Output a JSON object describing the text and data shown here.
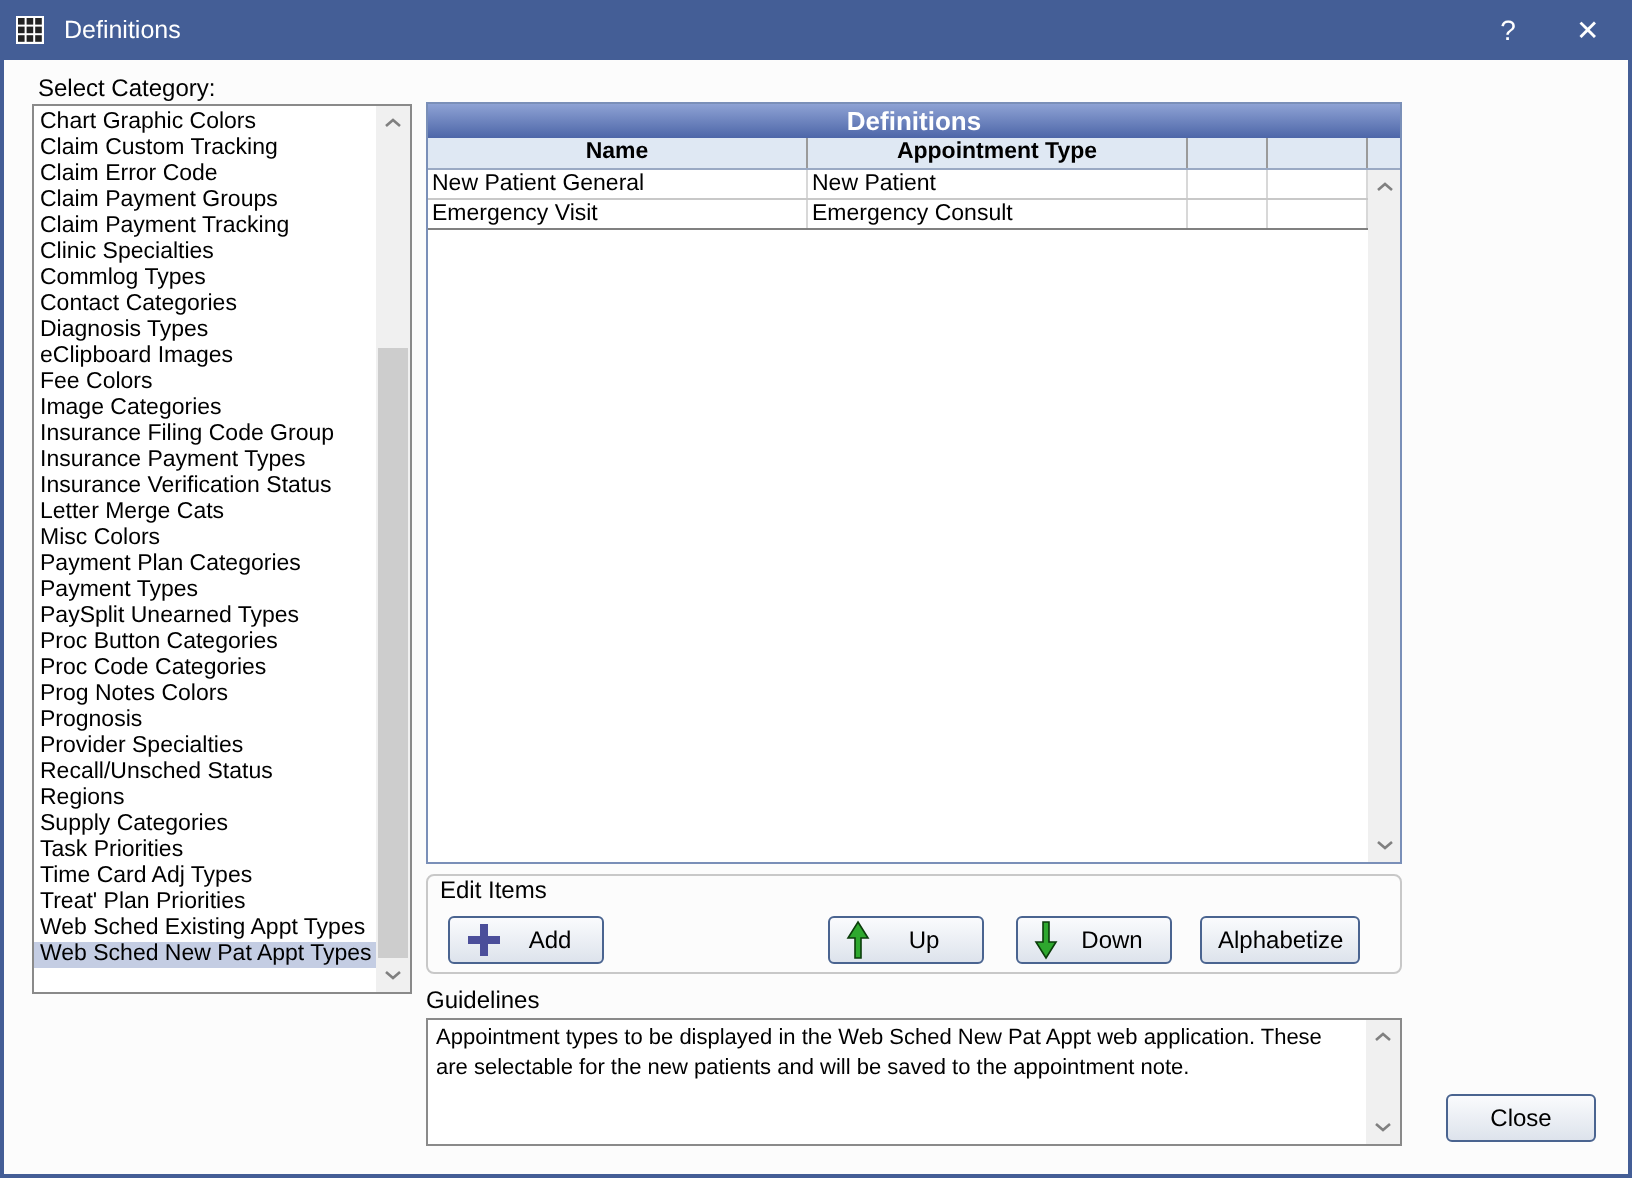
{
  "window": {
    "title": "Definitions",
    "help": "?",
    "close": "✕"
  },
  "category_list": {
    "label": "Select Category:",
    "items": [
      {
        "label": "Chart Graphic Colors",
        "selected": false
      },
      {
        "label": "Claim Custom Tracking",
        "selected": false
      },
      {
        "label": "Claim Error Code",
        "selected": false
      },
      {
        "label": "Claim Payment Groups",
        "selected": false
      },
      {
        "label": "Claim Payment Tracking",
        "selected": false
      },
      {
        "label": "Clinic Specialties",
        "selected": false
      },
      {
        "label": "Commlog Types",
        "selected": false
      },
      {
        "label": "Contact Categories",
        "selected": false
      },
      {
        "label": "Diagnosis Types",
        "selected": false
      },
      {
        "label": "eClipboard Images",
        "selected": false
      },
      {
        "label": "Fee Colors",
        "selected": false
      },
      {
        "label": "Image Categories",
        "selected": false
      },
      {
        "label": "Insurance Filing Code Group",
        "selected": false
      },
      {
        "label": "Insurance Payment Types",
        "selected": false
      },
      {
        "label": "Insurance Verification Status",
        "selected": false
      },
      {
        "label": "Letter Merge Cats",
        "selected": false
      },
      {
        "label": "Misc Colors",
        "selected": false
      },
      {
        "label": "Payment Plan Categories",
        "selected": false
      },
      {
        "label": "Payment Types",
        "selected": false
      },
      {
        "label": "PaySplit Unearned Types",
        "selected": false
      },
      {
        "label": "Proc Button Categories",
        "selected": false
      },
      {
        "label": "Proc Code Categories",
        "selected": false
      },
      {
        "label": "Prog Notes Colors",
        "selected": false
      },
      {
        "label": "Prognosis",
        "selected": false
      },
      {
        "label": "Provider Specialties",
        "selected": false
      },
      {
        "label": "Recall/Unsched Status",
        "selected": false
      },
      {
        "label": "Regions",
        "selected": false
      },
      {
        "label": "Supply Categories",
        "selected": false
      },
      {
        "label": "Task Priorities",
        "selected": false
      },
      {
        "label": "Time Card Adj Types",
        "selected": false
      },
      {
        "label": "Treat' Plan Priorities",
        "selected": false
      },
      {
        "label": "Web Sched Existing Appt Types",
        "selected": false
      },
      {
        "label": "Web Sched New Pat Appt Types",
        "selected": true
      }
    ]
  },
  "grid": {
    "title": "Definitions",
    "columns": [
      "Name",
      "Appointment Type"
    ],
    "rows": [
      [
        "New Patient General",
        "New Patient"
      ],
      [
        "Emergency Visit",
        "Emergency Consult"
      ]
    ]
  },
  "edit_items": {
    "label": "Edit Items",
    "buttons": [
      {
        "label": "Add",
        "kind": "add"
      },
      {
        "label": "Up",
        "kind": "up"
      },
      {
        "label": "Down",
        "kind": "down"
      },
      {
        "label": "Alphabetize",
        "kind": "plain"
      }
    ]
  },
  "guidelines": {
    "label": "Guidelines",
    "text": "Appointment types to be displayed in the Web Sched New Pat Appt web application.  These are selectable for the new patients and will be saved to the appointment note."
  },
  "close_button": "Close"
}
